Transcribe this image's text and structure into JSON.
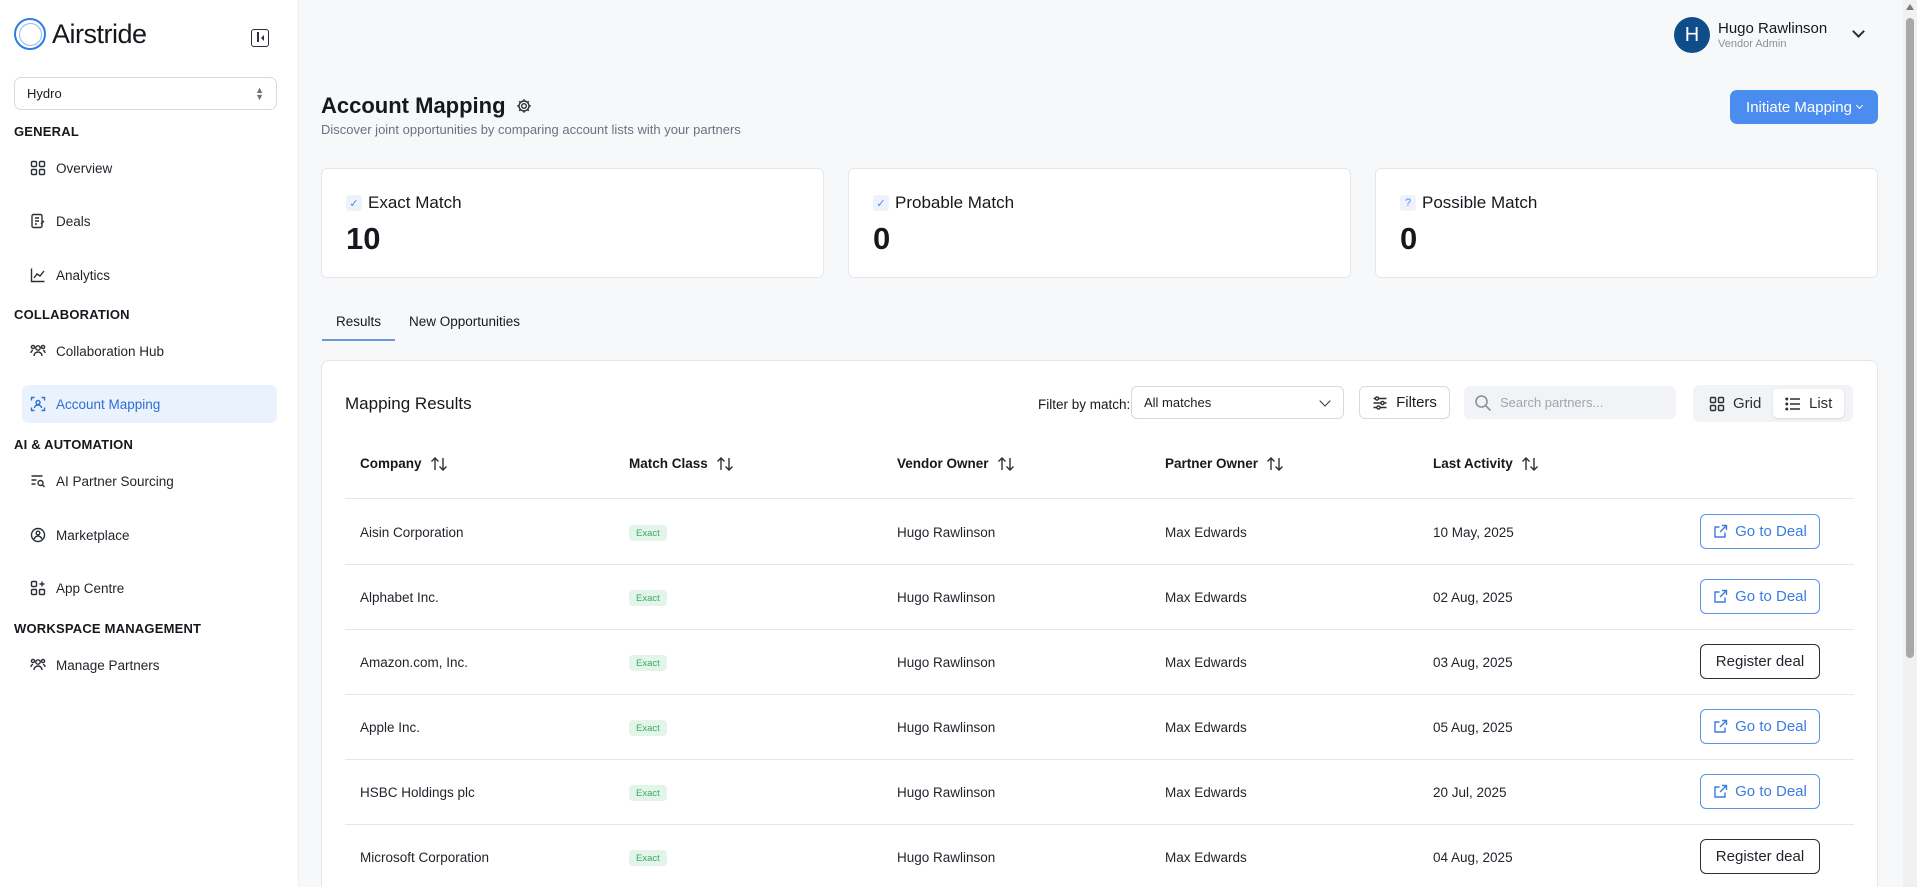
{
  "app": {
    "name": "Airstride"
  },
  "workspace": {
    "selected": "Hydro"
  },
  "sidebar": {
    "sections": [
      {
        "title": "GENERAL",
        "items": [
          {
            "label": "Overview",
            "icon": "grid-icon"
          },
          {
            "label": "Deals",
            "icon": "deals-icon"
          },
          {
            "label": "Analytics",
            "icon": "chart-icon"
          }
        ]
      },
      {
        "title": "COLLABORATION",
        "items": [
          {
            "label": "Collaboration Hub",
            "icon": "people-icon"
          },
          {
            "label": "Account Mapping",
            "icon": "scan-user-icon",
            "active": true
          }
        ]
      },
      {
        "title": "AI & AUTOMATION",
        "items": [
          {
            "label": "AI Partner Sourcing",
            "icon": "list-search-icon"
          },
          {
            "label": "Marketplace",
            "icon": "marketplace-icon"
          },
          {
            "label": "App Centre",
            "icon": "apps-icon"
          }
        ]
      },
      {
        "title": "WORKSPACE MANAGEMENT",
        "items": [
          {
            "label": "Manage Partners",
            "icon": "people-icon"
          }
        ]
      }
    ]
  },
  "user": {
    "initial": "H",
    "name": "Hugo Rawlinson",
    "role": "Vendor Admin"
  },
  "header": {
    "title": "Account Mapping",
    "subtitle": "Discover joint opportunities by comparing account lists with your partners",
    "initiate_label": "Initiate Mapping"
  },
  "stats": [
    {
      "label": "Exact Match",
      "value": "10",
      "badge": "✓"
    },
    {
      "label": "Probable Match",
      "value": "0",
      "badge": "✓"
    },
    {
      "label": "Possible Match",
      "value": "0",
      "badge": "?"
    }
  ],
  "tabs": [
    {
      "label": "Results",
      "active": true
    },
    {
      "label": "New Opportunities"
    }
  ],
  "results": {
    "title": "Mapping Results",
    "filter_label": "Filter by match:",
    "filter_value": "All matches",
    "filters_label": "Filters",
    "search_placeholder": "Search partners...",
    "view_grid": "Grid",
    "view_list": "List",
    "columns": [
      "Company",
      "Match Class",
      "Vendor Owner",
      "Partner Owner",
      "Last Activity"
    ],
    "rows": [
      {
        "company": "Aisin Corporation",
        "match": "Exact",
        "vendor": "Hugo Rawlinson",
        "partner": "Max Edwards",
        "activity": "10 May, 2025",
        "action": "Go to Deal",
        "action_type": "go"
      },
      {
        "company": "Alphabet Inc.",
        "match": "Exact",
        "vendor": "Hugo Rawlinson",
        "partner": "Max Edwards",
        "activity": "02 Aug, 2025",
        "action": "Go to Deal",
        "action_type": "go"
      },
      {
        "company": "Amazon.com, Inc.",
        "match": "Exact",
        "vendor": "Hugo Rawlinson",
        "partner": "Max Edwards",
        "activity": "03 Aug, 2025",
        "action": "Register deal",
        "action_type": "reg"
      },
      {
        "company": "Apple Inc.",
        "match": "Exact",
        "vendor": "Hugo Rawlinson",
        "partner": "Max Edwards",
        "activity": "05 Aug, 2025",
        "action": "Go to Deal",
        "action_type": "go"
      },
      {
        "company": "HSBC Holdings plc",
        "match": "Exact",
        "vendor": "Hugo Rawlinson",
        "partner": "Max Edwards",
        "activity": "20 Jul, 2025",
        "action": "Go to Deal",
        "action_type": "go"
      },
      {
        "company": "Microsoft Corporation",
        "match": "Exact",
        "vendor": "Hugo Rawlinson",
        "partner": "Max Edwards",
        "activity": "04 Aug, 2025",
        "action": "Register deal",
        "action_type": "reg"
      }
    ]
  },
  "colors": {
    "accent": "#4a8cf0",
    "active_bg": "#eaf2fd",
    "exact_badge_bg": "#e3f5e8",
    "exact_badge_text": "#3aa866",
    "avatar": "#0f4c8a"
  }
}
